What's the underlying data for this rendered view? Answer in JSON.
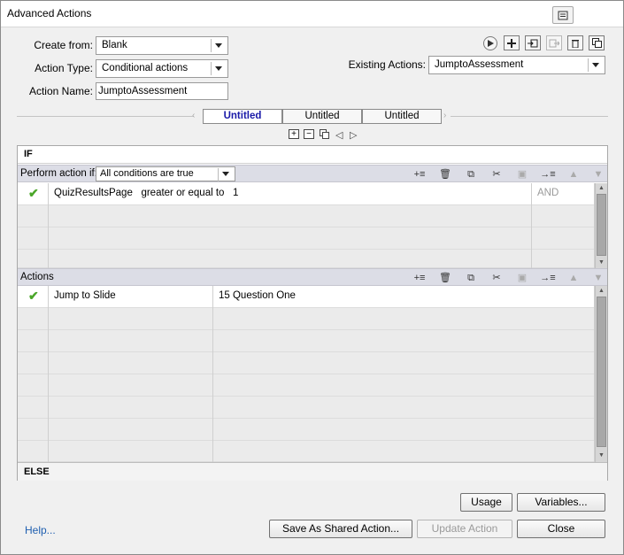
{
  "window": {
    "title": "Advanced Actions"
  },
  "form": {
    "create_from_label": "Create from:",
    "create_from_value": "Blank",
    "action_type_label": "Action Type:",
    "action_type_value": "Conditional actions",
    "action_name_label": "Action Name:",
    "action_name_value": "JumptoAssessment",
    "existing_label": "Existing Actions:",
    "existing_value": "JumptoAssessment"
  },
  "tabs": [
    {
      "label": "Untitled",
      "active": true
    },
    {
      "label": "Untitled",
      "active": false
    },
    {
      "label": "Untitled",
      "active": false
    }
  ],
  "if_section": {
    "label": "IF",
    "perform_label": "Perform action if:",
    "condition_select": "All conditions are true",
    "rows": [
      {
        "var": "QuizResultsPage",
        "op": "greater or equal to",
        "val": "1",
        "logic": "AND"
      }
    ]
  },
  "actions_section": {
    "label": "Actions",
    "rows": [
      {
        "action": "Jump to Slide",
        "target": "15 Question One"
      }
    ]
  },
  "else_label": "ELSE",
  "buttons": {
    "usage": "Usage",
    "variables": "Variables...",
    "save_shared": "Save As Shared Action...",
    "update": "Update Action",
    "close": "Close",
    "help": "Help..."
  },
  "icons": {
    "toolbar": [
      "play-icon",
      "add-icon",
      "import-icon",
      "export-icon",
      "delete-icon",
      "duplicate-icon"
    ],
    "check_color": "#4aa629"
  }
}
